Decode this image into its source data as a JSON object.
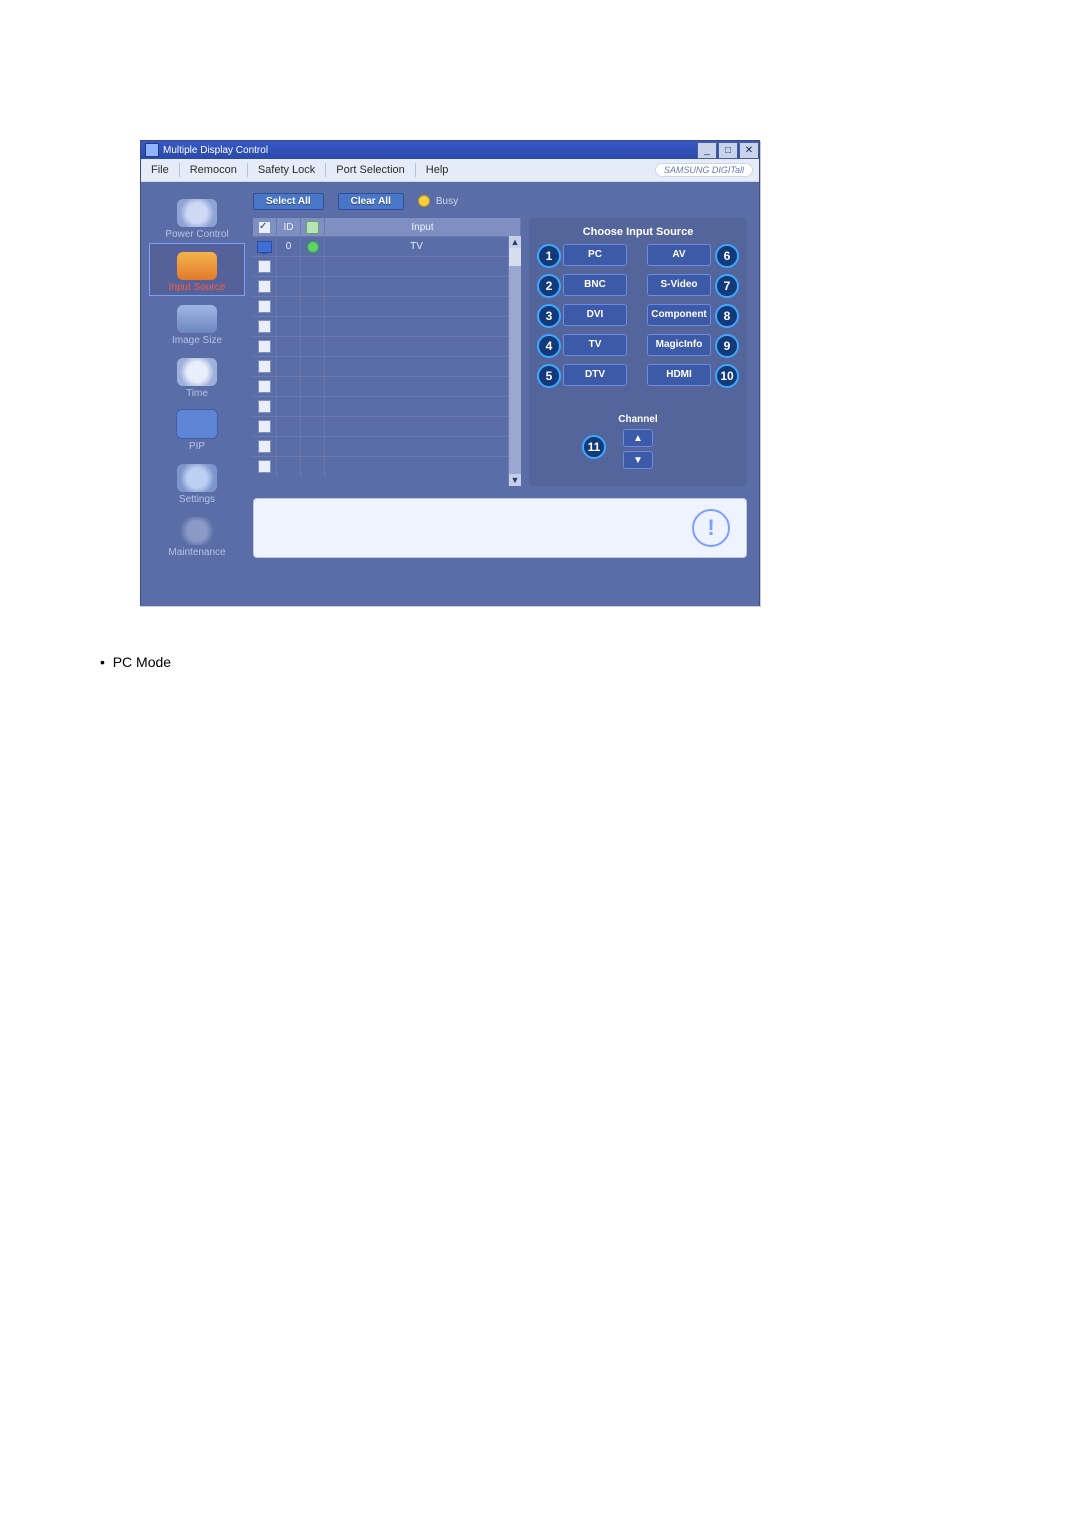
{
  "window": {
    "title": "Multiple Display Control",
    "brand": "SAMSUNG DIGITall"
  },
  "menu": {
    "items": [
      "File",
      "Remocon",
      "Safety Lock",
      "Port Selection",
      "Help"
    ]
  },
  "sidebar": {
    "items": [
      {
        "label": "Power Control",
        "active": false
      },
      {
        "label": "Input Source",
        "active": true
      },
      {
        "label": "Image Size",
        "active": false
      },
      {
        "label": "Time",
        "active": false
      },
      {
        "label": "PIP",
        "active": false
      },
      {
        "label": "Settings",
        "active": false
      },
      {
        "label": "Maintenance",
        "active": false
      }
    ]
  },
  "toolbar": {
    "select_all": "Select All",
    "clear_all": "Clear All",
    "busy": "Busy"
  },
  "table": {
    "headers": {
      "id": "ID",
      "input": "Input"
    },
    "rows": [
      {
        "checked": true,
        "id": "0",
        "status": "on",
        "input": "TV"
      },
      {
        "checked": false,
        "id": "",
        "status": "",
        "input": ""
      },
      {
        "checked": false,
        "id": "",
        "status": "",
        "input": ""
      },
      {
        "checked": false,
        "id": "",
        "status": "",
        "input": ""
      },
      {
        "checked": false,
        "id": "",
        "status": "",
        "input": ""
      },
      {
        "checked": false,
        "id": "",
        "status": "",
        "input": ""
      },
      {
        "checked": false,
        "id": "",
        "status": "",
        "input": ""
      },
      {
        "checked": false,
        "id": "",
        "status": "",
        "input": ""
      },
      {
        "checked": false,
        "id": "",
        "status": "",
        "input": ""
      },
      {
        "checked": false,
        "id": "",
        "status": "",
        "input": ""
      },
      {
        "checked": false,
        "id": "",
        "status": "",
        "input": ""
      },
      {
        "checked": false,
        "id": "",
        "status": "",
        "input": ""
      }
    ]
  },
  "right_panel": {
    "title": "Choose Input Source",
    "sources_left": [
      {
        "n": "1",
        "label": "PC"
      },
      {
        "n": "2",
        "label": "BNC"
      },
      {
        "n": "3",
        "label": "DVI"
      },
      {
        "n": "4",
        "label": "TV"
      },
      {
        "n": "5",
        "label": "DTV"
      }
    ],
    "sources_right": [
      {
        "n": "6",
        "label": "AV"
      },
      {
        "n": "7",
        "label": "S-Video"
      },
      {
        "n": "8",
        "label": "Component"
      },
      {
        "n": "9",
        "label": "MagicInfo"
      },
      {
        "n": "10",
        "label": "HDMI"
      }
    ],
    "channel_label": "Channel",
    "channel_num": "11"
  },
  "caption": "PC Mode"
}
